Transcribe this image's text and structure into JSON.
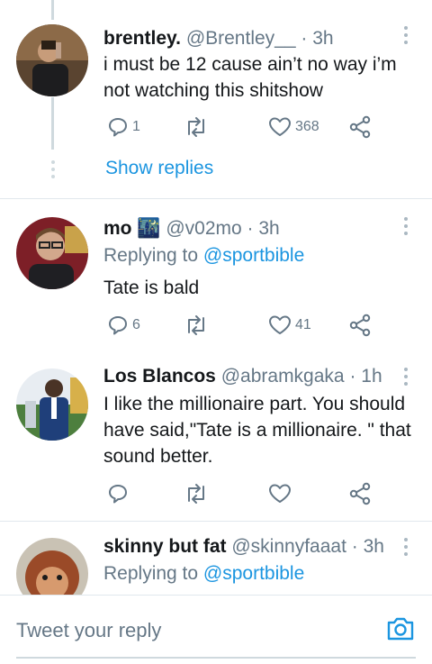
{
  "tweets": [
    {
      "name": "brentley.",
      "handle": "@Brentley__",
      "time": "· 3h",
      "text": "i must be 12 cause ain’t no way i’m not watching this shitshow",
      "replies": "1",
      "retweets": "",
      "likes": "368",
      "avatar_color": "#7a5a3a"
    },
    {
      "name": "mo",
      "emoji": "🌃",
      "handle": "@v02mo",
      "time": "· 3h",
      "replying_prefix": "Replying to",
      "replying_to": "@sportbible",
      "text": "Tate is bald",
      "replies": "6",
      "retweets": "",
      "likes": "41",
      "avatar_color": "#b0333a"
    },
    {
      "name": "Los Blancos",
      "handle": "@abramkgaka",
      "time": "· 1h",
      "text": "I like the millionaire part. You should have said,\"Tate is a millionaire. \" that sound better.",
      "replies": "",
      "retweets": "",
      "likes": "",
      "avatar_color": "#3d6fa8"
    },
    {
      "name": "skinny but fat",
      "handle": "@skinnyfaaat",
      "time": "· 3h",
      "replying_prefix": "Replying to",
      "replying_to": "@sportbible",
      "avatar_color": "#a0522d"
    }
  ],
  "show_replies": "Show replies",
  "reply_bar": {
    "placeholder": "Tweet your reply"
  },
  "colors": {
    "accent": "#1b95e0",
    "secondary_text": "#657786",
    "divider": "#e1e8ed"
  }
}
